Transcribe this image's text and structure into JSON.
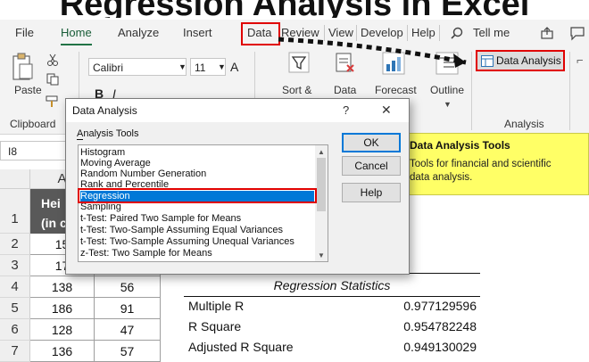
{
  "title": "Regression Analysis in Excel",
  "ribbon_tabs": [
    "File",
    "Home",
    "Analyze",
    "Insert",
    "Data",
    "Review",
    "View",
    "Develop",
    "Help",
    "Tell me"
  ],
  "ribbon": {
    "clipboard_label": "Clipboard",
    "paste_label": "Paste",
    "font_name": "Calibri",
    "font_size": "11",
    "font_grow": "A",
    "bold": "B",
    "italic": "I",
    "sort_label": "Sort &",
    "data_label": "Data",
    "forecast_label": "Forecast",
    "outline_label": "Outline",
    "data_analysis_button": "Data Analysis",
    "analysis_group_label": "Analysis"
  },
  "formula_bar": {
    "name_box": "I8"
  },
  "sheet": {
    "col_headers": [
      "A"
    ],
    "row_numbers": [
      "1",
      "2",
      "3",
      "4",
      "5",
      "6",
      "7"
    ],
    "header_line1": "Hei",
    "header_line2": "(in c",
    "rows": [
      {
        "a": "15",
        "b": ""
      },
      {
        "a": "17",
        "b": ""
      },
      {
        "a": "138",
        "b": "56"
      },
      {
        "a": "186",
        "b": "91"
      },
      {
        "a": "128",
        "b": "47"
      },
      {
        "a": "136",
        "b": "57"
      }
    ]
  },
  "regression_stats": {
    "header": "Regression Statistics",
    "rows": [
      {
        "label": "Multiple R",
        "value": "0.977129596"
      },
      {
        "label": "R Square",
        "value": "0.954782248"
      },
      {
        "label": "Adjusted R Square",
        "value": "0.949130029"
      }
    ]
  },
  "tooltip": {
    "title": "Data Analysis Tools",
    "body": "Tools for financial and scientific data analysis."
  },
  "dialog": {
    "title": "Data Analysis",
    "help_glyph": "?",
    "close_glyph": "✕",
    "tools_label": "Analysis Tools",
    "tools": [
      "Histogram",
      "Moving Average",
      "Random Number Generation",
      "Rank and Percentile",
      "Regression",
      "Sampling",
      "t-Test: Paired Two Sample for Means",
      "t-Test: Two-Sample Assuming Equal Variances",
      "t-Test: Two-Sample Assuming Unequal Variances",
      "z-Test: Two Sample for Means"
    ],
    "selected_tool": "Regression",
    "ok": "OK",
    "cancel": "Cancel",
    "help": "Help"
  },
  "colors": {
    "highlight_red": "#e00000",
    "excel_green": "#217346",
    "selection_blue": "#0078d7",
    "tooltip_yellow": "#ffff66",
    "table_header": "#595959"
  }
}
